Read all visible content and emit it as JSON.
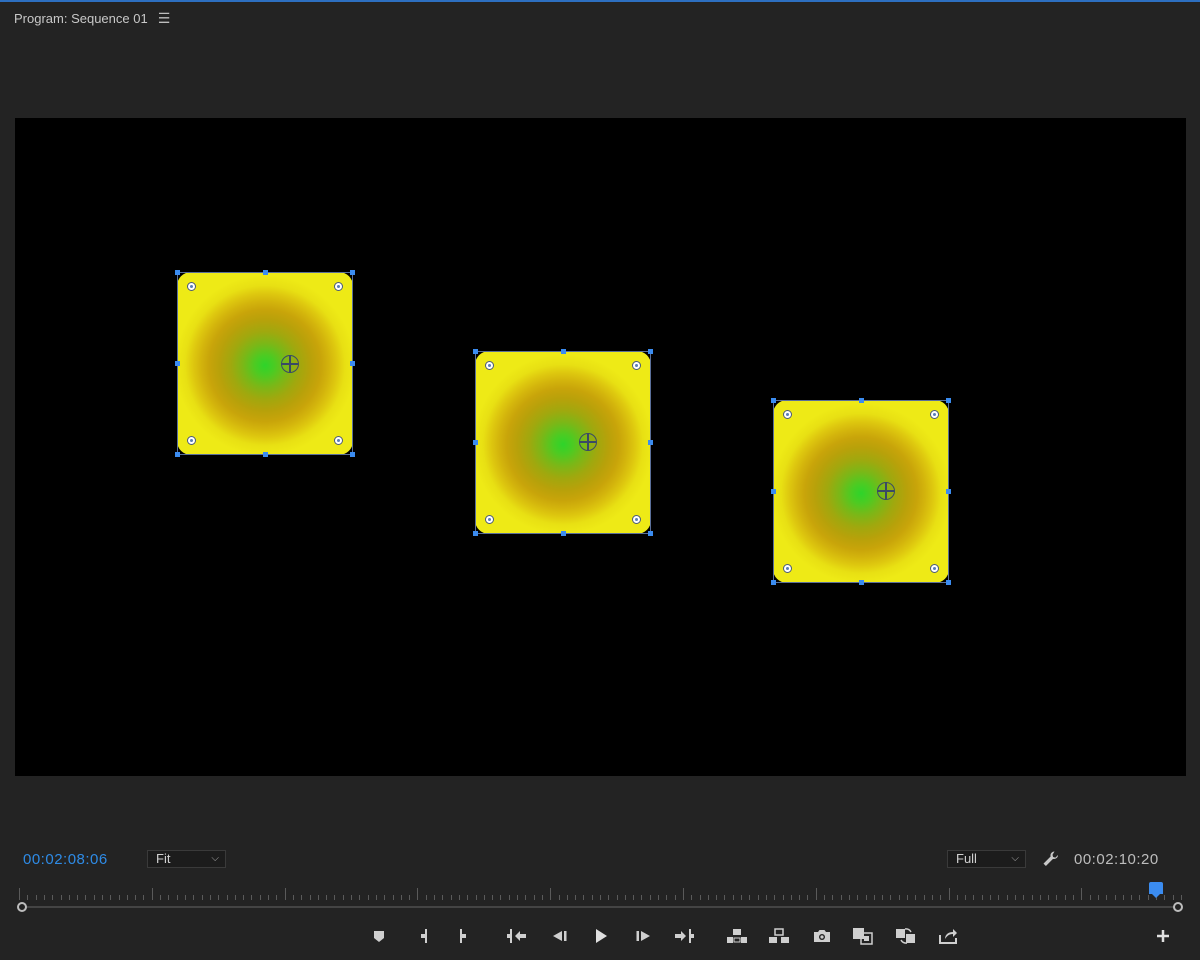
{
  "panel": {
    "title": "Program: Sequence 01",
    "menu_icon": "hamburger-icon"
  },
  "viewer": {
    "background": "#000000"
  },
  "clips": [
    {
      "name": "clip-1"
    },
    {
      "name": "clip-2"
    },
    {
      "name": "clip-3"
    }
  ],
  "controls": {
    "current_timecode": "00:02:08:06",
    "duration_timecode": "00:02:10:20",
    "zoom": {
      "selected": "Fit"
    },
    "resolution": {
      "selected": "Full"
    }
  },
  "transport_buttons": [
    {
      "name": "add-marker-button",
      "icon": "marker-icon"
    },
    {
      "name": "mark-in-button",
      "icon": "mark-in-icon"
    },
    {
      "name": "mark-out-button",
      "icon": "mark-out-icon"
    },
    {
      "name": "go-to-in-button",
      "icon": "go-to-in-icon"
    },
    {
      "name": "step-back-button",
      "icon": "step-back-icon"
    },
    {
      "name": "play-button",
      "icon": "play-icon"
    },
    {
      "name": "step-forward-button",
      "icon": "step-forward-icon"
    },
    {
      "name": "go-to-out-button",
      "icon": "go-to-out-icon"
    },
    {
      "name": "lift-button",
      "icon": "lift-icon"
    },
    {
      "name": "extract-button",
      "icon": "extract-icon"
    },
    {
      "name": "export-frame-button",
      "icon": "camera-icon"
    },
    {
      "name": "comparison-view-button",
      "icon": "comparison-view-icon"
    },
    {
      "name": "toggle-proxies-button",
      "icon": "proxy-icon"
    },
    {
      "name": "export-button",
      "icon": "export-icon"
    }
  ],
  "colors": {
    "accent": "#3b8cf0",
    "timecode_current": "#2e8be6",
    "clip_yellow": "#eeea16",
    "clip_green": "#2ed42a"
  }
}
